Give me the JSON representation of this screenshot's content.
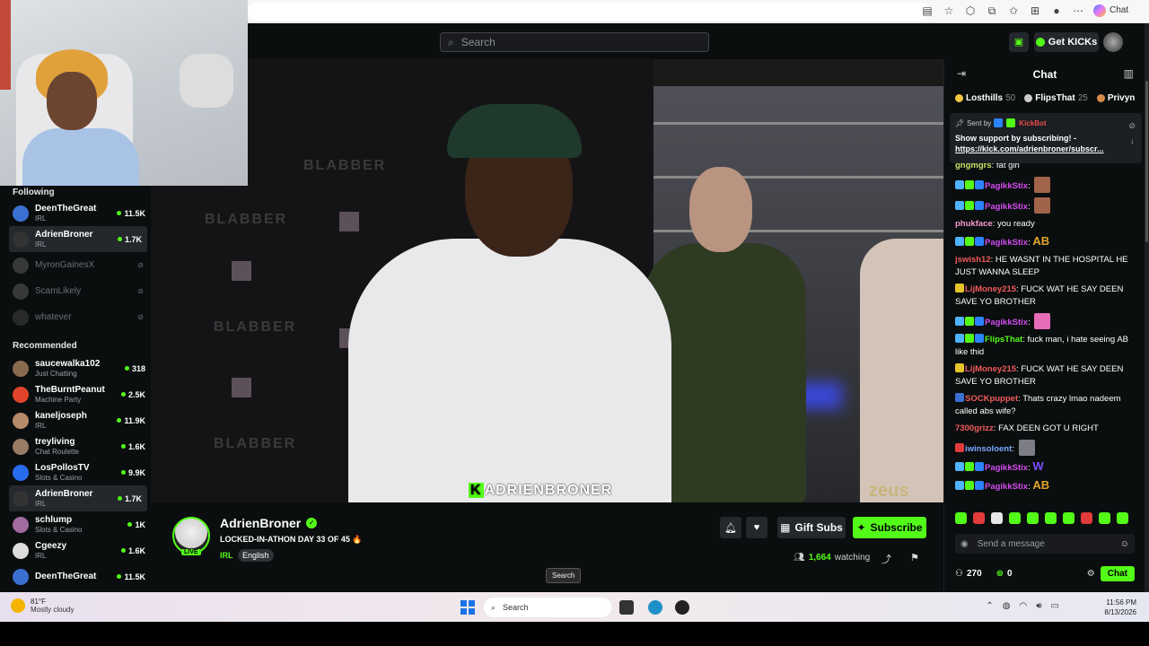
{
  "browser": {
    "copilot_label": "Chat"
  },
  "header": {
    "search_placeholder": "Search",
    "get_kicks": "Get KICKs"
  },
  "sidebar": {
    "following_heading": "Following",
    "following": [
      {
        "name": "DeenTheGreat",
        "category": "IRL",
        "viewers": "11.5K",
        "live": true,
        "avatar_color": "#3b6fd1"
      },
      {
        "name": "AdrienBroner",
        "category": "IRL",
        "viewers": "1.7K",
        "live": true,
        "avatar_color": "#333333",
        "active": true
      },
      {
        "name": "MyronGainesX",
        "category": "",
        "viewers": "",
        "live": false,
        "avatar_color": "#777777"
      },
      {
        "name": "ScamLikely",
        "category": "",
        "viewers": "",
        "live": false,
        "avatar_color": "#777777"
      },
      {
        "name": "whatever",
        "category": "",
        "viewers": "",
        "live": false,
        "avatar_color": "#555555"
      }
    ],
    "recommended_heading": "Recommended",
    "recommended": [
      {
        "name": "saucewalka102",
        "category": "Just Chatting",
        "viewers": "318",
        "avatar_color": "#8a6a4f"
      },
      {
        "name": "TheBurntPeanut",
        "category": "Machine Party",
        "viewers": "2.5K",
        "avatar_color": "#e0452b"
      },
      {
        "name": "kaneljoseph",
        "category": "IRL",
        "viewers": "11.9K",
        "avatar_color": "#b58b6a"
      },
      {
        "name": "treyliving",
        "category": "Chat Roulette",
        "viewers": "1.6K",
        "avatar_color": "#9a7b64"
      },
      {
        "name": "LosPollosTV",
        "category": "Slots & Casino",
        "viewers": "9.9K",
        "avatar_color": "#2a6cf0"
      },
      {
        "name": "AdrienBroner",
        "category": "IRL",
        "viewers": "1.7K",
        "avatar_color": "#333333",
        "active": true
      },
      {
        "name": "schlump",
        "category": "Slots & Casino",
        "viewers": "1K",
        "avatar_color": "#a16aa0"
      },
      {
        "name": "Cgeezy",
        "category": "IRL",
        "viewers": "1.6K",
        "avatar_color": "#dddddd"
      },
      {
        "name": "DeenTheGreat",
        "category": "",
        "viewers": "11.5K",
        "avatar_color": "#3b6fd1"
      }
    ]
  },
  "video": {
    "overlay_prefix": "K",
    "overlay_name": "ADRIENBRONER",
    "sponsor": "zeus"
  },
  "stream": {
    "channel": "AdrienBroner",
    "live_label": "LIVE",
    "title": "LOCKED-IN-ATHON DAY 33 OF 45 🔥",
    "category": "IRL",
    "language": "English",
    "gift_subs": "Gift Subs",
    "subscribe": "Subscribe",
    "viewers": "1,664",
    "watching_label": "watching",
    "tooltip": "Search"
  },
  "chat": {
    "title": "Chat",
    "top_gifters": [
      {
        "name": "Losthills",
        "count": "50",
        "color": "#f5c542"
      },
      {
        "name": "FlipsThat",
        "count": "25",
        "color": "#cccccc"
      },
      {
        "name": "Privyn",
        "count": "",
        "color": "#d98c4a"
      }
    ],
    "pinned": {
      "sent_by": "Sent by",
      "bot": "KickBot",
      "text": "Show support by subscribing! -",
      "link": "https://kick.com/adrienbroner/subscr..."
    },
    "messages": [
      {
        "user": "gngmgrs",
        "color": "#c8e66a",
        "text": "fat girl",
        "emote": ""
      },
      {
        "user": "PagikkStix",
        "color": "#d24cf0",
        "text": "",
        "emote": "#a0644a",
        "badges": [
          "#4fb3ff",
          "#53fc18",
          "#2b84ff"
        ]
      },
      {
        "user": "PagikkStix",
        "color": "#d24cf0",
        "text": "",
        "emote": "#a0644a",
        "badges": [
          "#4fb3ff",
          "#53fc18",
          "#2b84ff"
        ]
      },
      {
        "user": "phukface",
        "color": "#f59ad1",
        "text": "you ready",
        "emote": ""
      },
      {
        "user": "PagikkStix",
        "color": "#d24cf0",
        "text": "AB",
        "emote": "",
        "badges": [
          "#4fb3ff",
          "#53fc18",
          "#2b84ff"
        ]
      },
      {
        "user": "jswish12",
        "color": "#f25a5a",
        "text": "HE WASNT IN THE HOSPITAL HE JUST WANNA SLEEP",
        "emote": ""
      },
      {
        "user": "LijMoney215",
        "color": "#f25a5a",
        "text": "FUCK WAT HE SAY DEEN SAVE YO BROTHER",
        "emote": "",
        "badges": [
          "#e3c52a"
        ]
      },
      {
        "user": "PagikkStix",
        "color": "#d24cf0",
        "text": "",
        "emote": "#e66bb8",
        "badges": [
          "#4fb3ff",
          "#53fc18",
          "#2b84ff"
        ]
      },
      {
        "user": "FlipsThat",
        "color": "#53fc18",
        "text": "fuck man, i hate seeing AB like thid",
        "emote": "",
        "badges": [
          "#4fb3ff",
          "#53fc18",
          "#2b84ff"
        ]
      },
      {
        "user": "LijMoney215",
        "color": "#f25a5a",
        "text": "FUCK WAT HE SAY DEEN SAVE YO BROTHER",
        "emote": "",
        "badges": [
          "#e3c52a"
        ]
      },
      {
        "user": "SOCKpuppet",
        "color": "#f25a5a",
        "text": "Thats crazy lmao nadeem called abs wife?",
        "emote": "",
        "badges": [
          "#3b6fd1"
        ]
      },
      {
        "user": "7300grizz",
        "color": "#f25a5a",
        "text": "FAX DEEN GOT U RIGHT",
        "emote": ""
      },
      {
        "user": "iwinsoloent",
        "color": "#7aa8ff",
        "text": "",
        "emote": "#7d7d85",
        "badges": [
          "#e23b3b"
        ]
      },
      {
        "user": "PagikkStix",
        "color": "#d24cf0",
        "text": "W",
        "emote": "",
        "badges": [
          "#4fb3ff",
          "#53fc18",
          "#2b84ff"
        ]
      },
      {
        "user": "PagikkStix",
        "color": "#d24cf0",
        "text": "AB",
        "emote": "",
        "badges": [
          "#4fb3ff",
          "#53fc18",
          "#2b84ff"
        ]
      }
    ],
    "input_placeholder": "Send a message",
    "points": "270",
    "kicks": "0",
    "chat_button": "Chat"
  },
  "taskbar": {
    "temp": "81°F",
    "weather": "Mostly cloudy",
    "search": "Search",
    "time": "11:56 PM",
    "date": "8/13/2026"
  },
  "colors": {
    "accent": "#53fc18",
    "background": "#0b0e0f"
  }
}
